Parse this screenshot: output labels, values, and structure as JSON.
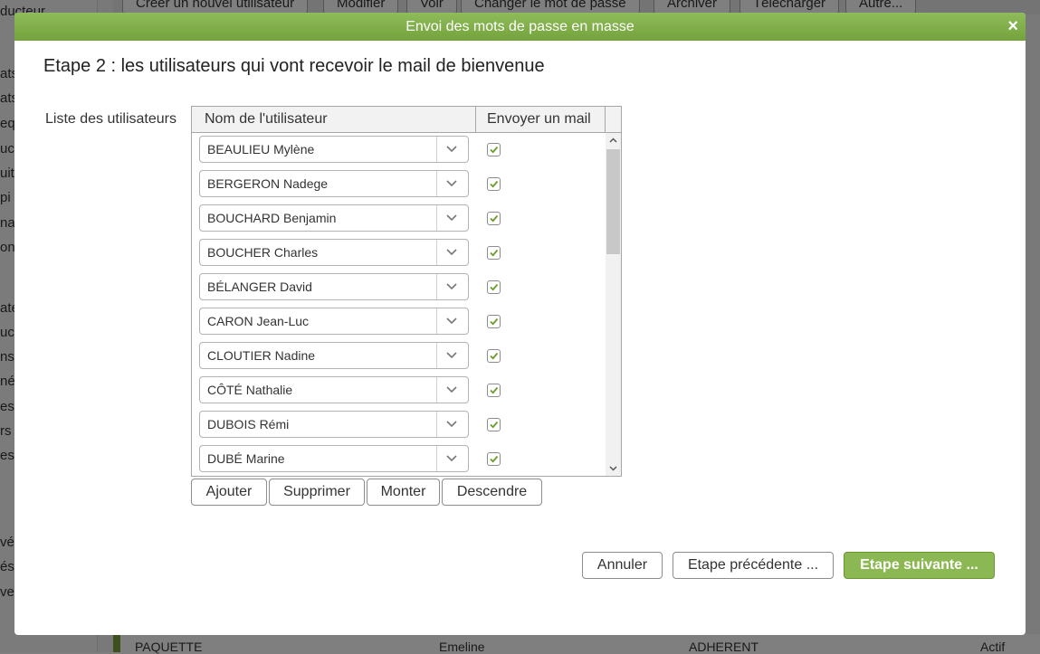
{
  "background": {
    "toolbar": [
      "Créer un nouvel utilisateur",
      "Modifier",
      "Voir",
      "Changer le mot de passe",
      "Archiver",
      "Télécharger",
      "Autre..."
    ],
    "left_items": [
      "ducteur",
      "ats",
      "ats",
      "equ",
      "uct",
      "uits",
      "pi",
      "nap",
      "on",
      "ate",
      "uct",
      "ns",
      "nés",
      "es",
      "rs",
      "es",
      "vés",
      "és",
      "ves"
    ],
    "row": [
      "PAQUETTE",
      "Emeline",
      "ADHERENT",
      "Actif"
    ]
  },
  "modal": {
    "title": "Envoi des mots de passe en masse",
    "close": "×",
    "step_title": "Etape 2 : les utilisateurs qui vont recevoir le mail de bienvenue",
    "list_label": "Liste des utilisateurs",
    "columns": [
      "Nom de l'utilisateur",
      "Envoyer un mail"
    ],
    "rows": [
      {
        "name": "BEAULIEU Mylène",
        "send": true
      },
      {
        "name": "BERGERON Nadege",
        "send": true
      },
      {
        "name": "BOUCHARD Benjamin",
        "send": true
      },
      {
        "name": "BOUCHER Charles",
        "send": true
      },
      {
        "name": "BÉLANGER David",
        "send": true
      },
      {
        "name": "CARON Jean-Luc",
        "send": true
      },
      {
        "name": "CLOUTIER Nadine",
        "send": true
      },
      {
        "name": "CÔTÉ Nathalie",
        "send": true
      },
      {
        "name": "DUBOIS Rémi",
        "send": true
      },
      {
        "name": "DUBÉ Marine",
        "send": true
      }
    ],
    "list_buttons": {
      "add": "Ajouter",
      "remove": "Supprimer",
      "up": "Monter",
      "down": "Descendre"
    },
    "footer": {
      "cancel": "Annuler",
      "prev": "Etape précédente ...",
      "next": "Etape suivante ..."
    }
  },
  "colors": {
    "accent": "#7aa33f",
    "check": "#6a9a2a"
  }
}
